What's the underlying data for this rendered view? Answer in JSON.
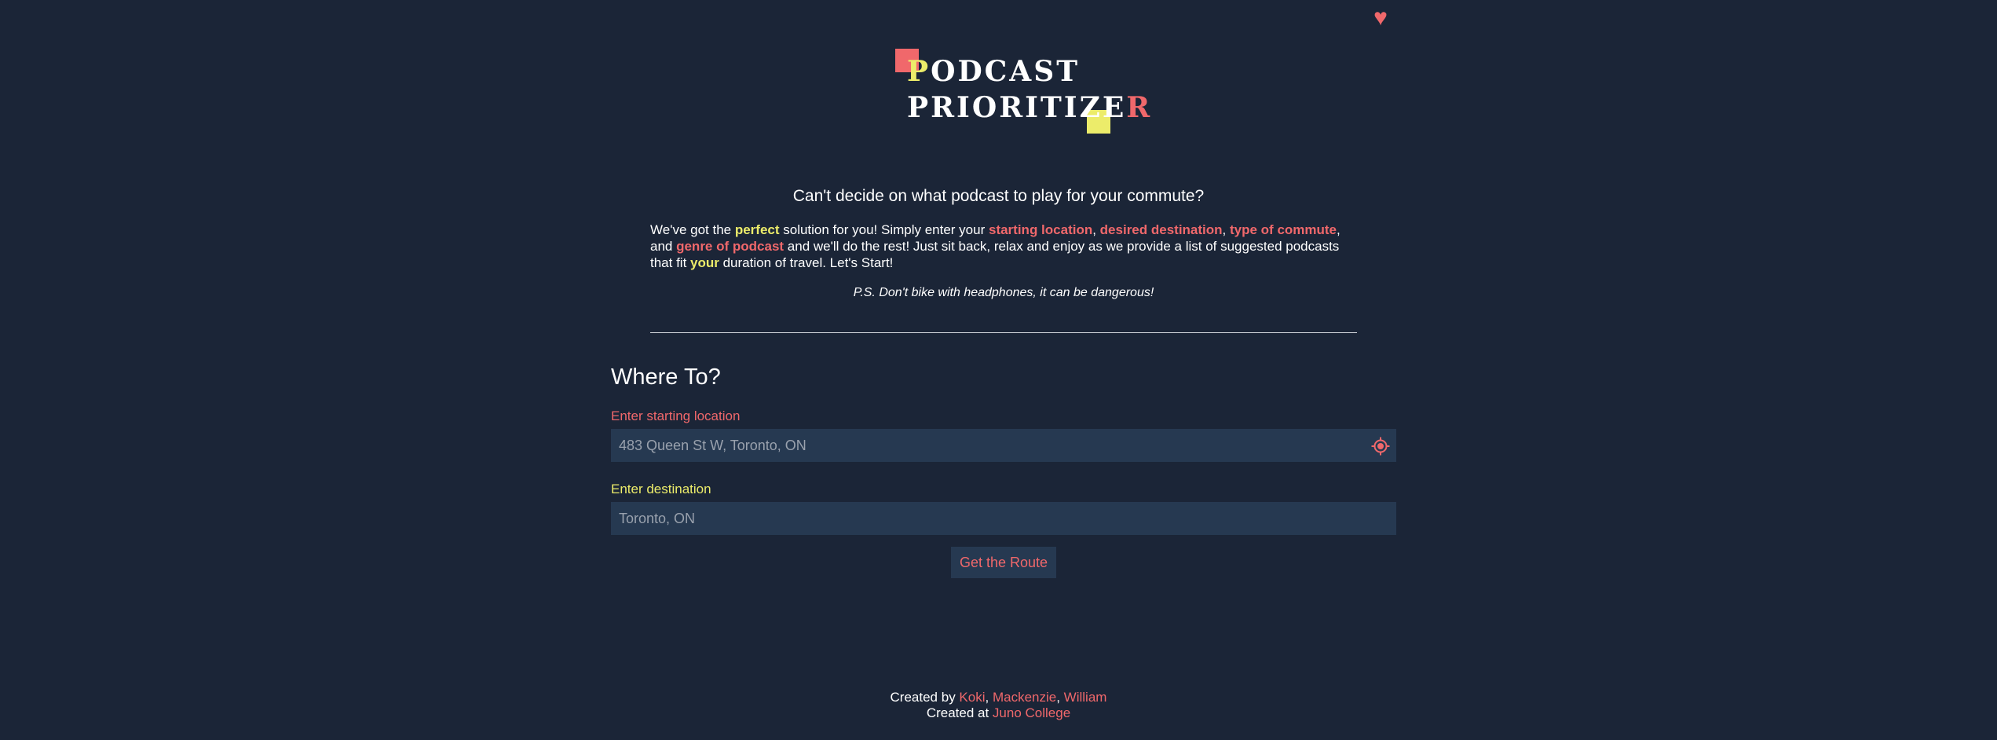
{
  "header": {
    "favorites_icon": "heart-icon",
    "logo": {
      "line1_first": "P",
      "line1_rest": "ODCAST",
      "line2_main": "PRIORITIZE",
      "line2_last": "R"
    }
  },
  "intro": {
    "question": "Can't decide on what podcast to play for your commute?",
    "t1": "We've got the ",
    "h_perfect": "perfect",
    "t2": " solution for you! Simply enter your ",
    "h_start": "starting location",
    "c1": ", ",
    "h_dest": "desired destination",
    "c2": ", ",
    "h_type": "type of commute",
    "t3": ", and ",
    "h_genre": "genre of podcast",
    "t4": " and we'll do the rest! Just sit back, relax and enjoy as we provide a list of suggested podcasts that fit ",
    "h_your": "your",
    "t5": " duration of travel. Let's Start!",
    "ps": "P.S. Don't bike with headphones, it can be dangerous!"
  },
  "form": {
    "title": "Where To?",
    "start_label": "Enter starting location",
    "start_placeholder": "483 Queen St W, Toronto, ON",
    "start_value": "",
    "locate_icon": "crosshair-location-icon",
    "dest_label": "Enter destination",
    "dest_placeholder": "Toronto, ON",
    "dest_value": "",
    "submit_label": "Get the Route"
  },
  "footer": {
    "created_by": "Created by ",
    "authors": [
      "Koki",
      "Mackenzie",
      "William"
    ],
    "sep": ", ",
    "created_at": "Created at ",
    "school": "Juno College"
  },
  "colors": {
    "background": "#1b2537",
    "field_bg": "#263951",
    "accent_red": "#f0686b",
    "accent_yellow": "#ecec6a"
  }
}
